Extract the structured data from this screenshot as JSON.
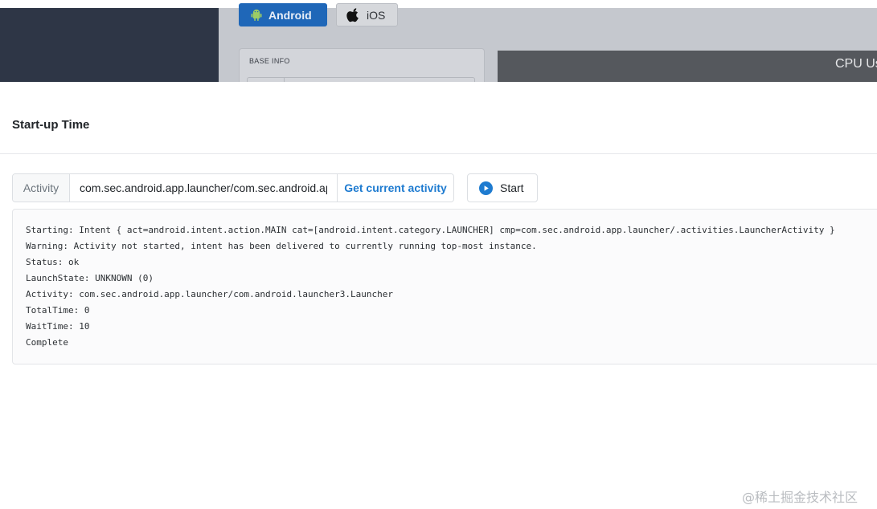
{
  "background": {
    "tabs": {
      "android": "Android",
      "ios": "iOS"
    },
    "base_info_title": "BASE INFO",
    "cpu_title": "CPU Us"
  },
  "modal": {
    "title": "Start-up Time",
    "activity_label": "Activity",
    "activity_value": "com.sec.android.app.launcher/com.sec.android.ap",
    "get_activity_label": "Get current activity",
    "start_label": "Start",
    "output_lines": [
      "Starting: Intent { act=android.intent.action.MAIN cat=[android.intent.category.LAUNCHER] cmp=com.sec.android.app.launcher/.activities.LauncherActivity }",
      "Warning: Activity not started, intent has been delivered to currently running top-most instance.",
      "Status: ok",
      "LaunchState: UNKNOWN (0)",
      "Activity: com.sec.android.app.launcher/com.android.launcher3.Launcher",
      "TotalTime: 0",
      "WaitTime: 10",
      "Complete"
    ]
  },
  "watermark": "@稀土掘金技术社区",
  "colors": {
    "accent": "#1e7bd0",
    "android_tab": "#1f67b8",
    "sidebar": "#2e3646"
  }
}
